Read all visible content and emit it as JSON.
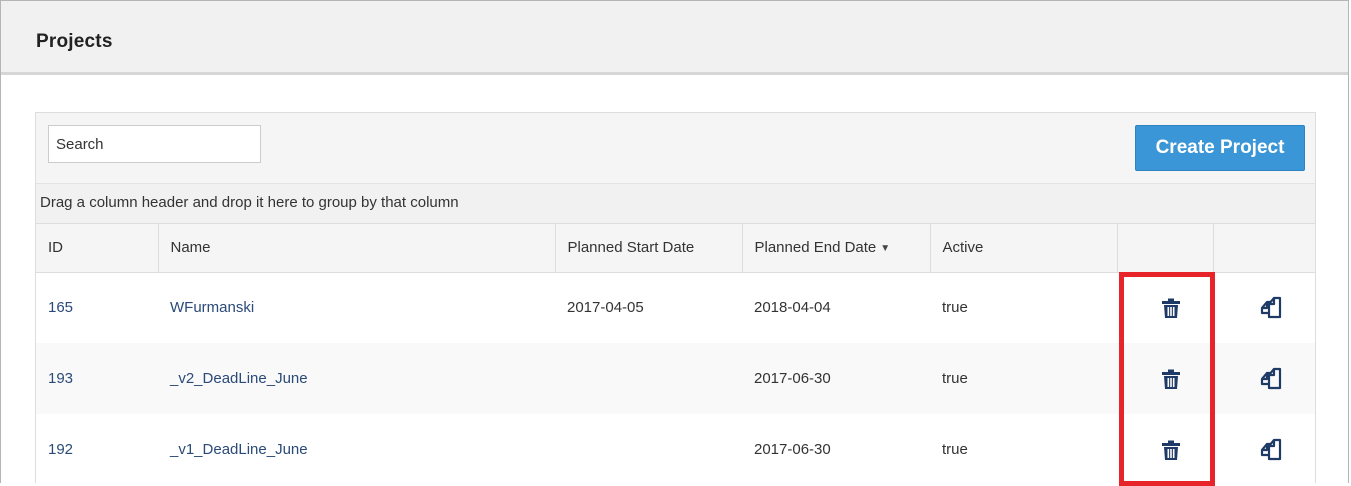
{
  "panel": {
    "title": "Projects"
  },
  "toolbar": {
    "search_placeholder": "Search",
    "create_label": "Create Project"
  },
  "group_bar": {
    "hint": "Drag a column header and drop it here to group by that column"
  },
  "table": {
    "columns": [
      "ID",
      "Name",
      "Planned Start Date",
      "Planned End Date",
      "Active",
      "",
      ""
    ],
    "sorted_column": "Planned End Date",
    "sort_direction": "descending",
    "rows": [
      {
        "id": "165",
        "name": "WFurmanski",
        "start": "2017-04-05",
        "end": "2018-04-04",
        "active": "true"
      },
      {
        "id": "193",
        "name": "_v2_DeadLine_June",
        "start": "",
        "end": "2017-06-30",
        "active": "true"
      },
      {
        "id": "192",
        "name": "_v1_DeadLine_June",
        "start": "",
        "end": "2017-06-30",
        "active": "true"
      }
    ]
  },
  "icons": {
    "delete": "trash-icon",
    "copy": "copy-icon"
  },
  "colors": {
    "accent_button": "#3a96d6",
    "link_text": "#2a4a78",
    "highlight": "#e8242b",
    "icon": "#1f3a66"
  }
}
